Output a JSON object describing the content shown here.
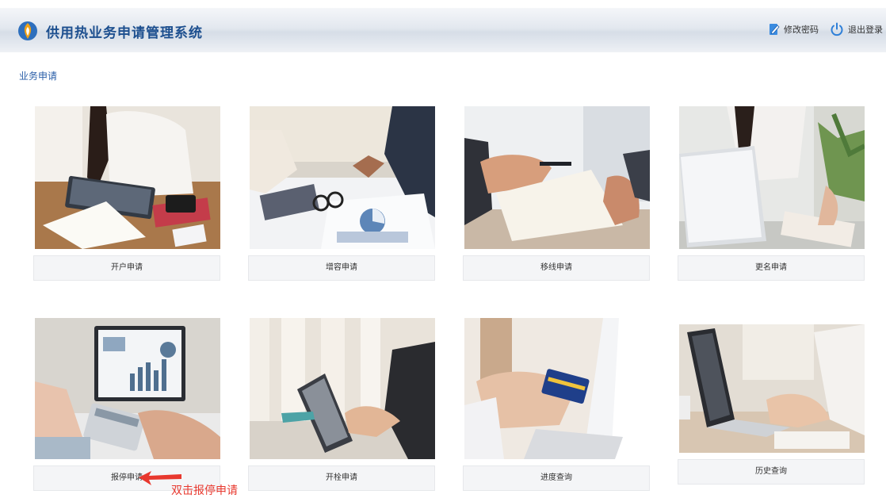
{
  "app": {
    "title": "供用热业务申请管理系统",
    "change_password": "修改密码",
    "logout": "退出登录"
  },
  "breadcrumb": "业务申请",
  "cards": [
    {
      "label": "开户申请",
      "icon": "photo-notebook-tablet-desk"
    },
    {
      "label": "增容申请",
      "icon": "photo-business-documents-pens"
    },
    {
      "label": "移线申请",
      "icon": "photo-handshake-document"
    },
    {
      "label": "更名申请",
      "icon": "photo-laptop-tablet-woman"
    },
    {
      "label": "报停申请",
      "icon": "photo-calculator-charts"
    },
    {
      "label": "开栓申请",
      "icon": "photo-tablet-stand-hand"
    },
    {
      "label": "进度查询",
      "icon": "photo-credit-card-laptop"
    },
    {
      "label": "历史查询",
      "icon": "photo-laptop-typing-desk"
    }
  ],
  "annotation": {
    "text": "双击报停申请"
  },
  "colors": {
    "title": "#1d4f8f",
    "annotation": "#e8382e"
  }
}
